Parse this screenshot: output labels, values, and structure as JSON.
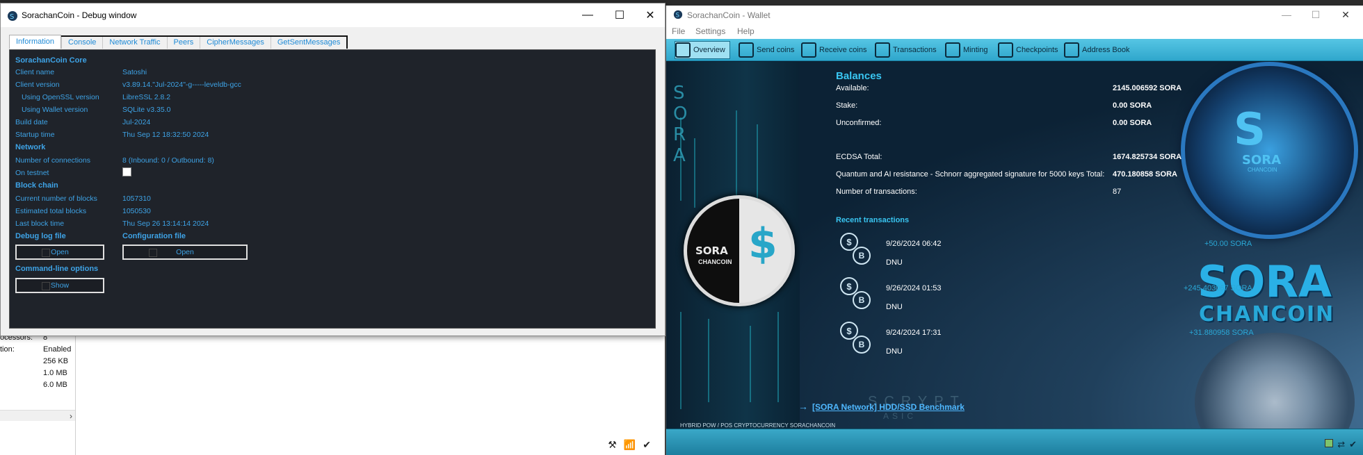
{
  "background": {
    "rows": [
      {
        "label": "ocessors:",
        "value": "8"
      },
      {
        "label": "tion:",
        "value": "Enabled"
      },
      {
        "label": "",
        "value": "256 KB"
      },
      {
        "label": "",
        "value": "1.0 MB"
      },
      {
        "label": "",
        "value": "6.0 MB"
      }
    ],
    "status_icons": [
      "⚒",
      "📶",
      "✔"
    ]
  },
  "debug": {
    "title": "SorachanCoin - Debug window",
    "tabs": [
      "Information",
      "Console",
      "Network Traffic",
      "Peers",
      "CipherMessages",
      "GetSentMessages"
    ],
    "active_tab": 0,
    "sections": {
      "core": "SorachanCoin Core",
      "network": "Network",
      "blockchain": "Block chain",
      "debug_log": "Debug log file",
      "config_file": "Configuration file",
      "cmdline": "Command-line options"
    },
    "info": {
      "client_name": {
        "label": "Client name",
        "value": "Satoshi"
      },
      "client_version": {
        "label": "Client version",
        "value": "v3.89.14.\"Jul-2024\"-g-----leveldb-gcc"
      },
      "openssl": {
        "label": "Using OpenSSL version",
        "value": "LibreSSL 2.8.2"
      },
      "wallet_ver": {
        "label": "Using Wallet version",
        "value": "SQLite v3.35.0"
      },
      "build_date": {
        "label": "Build date",
        "value": "Jul-2024"
      },
      "startup": {
        "label": "Startup time",
        "value": "Thu Sep 12 18:32:50 2024"
      },
      "connections": {
        "label": "Number of connections",
        "value": "8 (Inbound: 0 / Outbound: 8)"
      },
      "testnet": {
        "label": "On testnet",
        "value": ""
      },
      "cur_blocks": {
        "label": "Current number of blocks",
        "value": "1057310"
      },
      "est_blocks": {
        "label": "Estimated total blocks",
        "value": "1050530"
      },
      "last_block": {
        "label": "Last block time",
        "value": "Thu Sep 26 13:14:14 2024"
      }
    },
    "buttons": {
      "open_log": "Open",
      "open_config": "Open",
      "show": "Show"
    }
  },
  "wallet": {
    "title": "SorachanCoin - Wallet",
    "menu": [
      "File",
      "Settings",
      "Help"
    ],
    "toolbar": [
      "Overview",
      "Send coins",
      "Receive coins",
      "Transactions",
      "Minting",
      "Checkpoints",
      "Address Book"
    ],
    "active_toolbar": 0,
    "art": {
      "sora_letters": "S O R A",
      "coin_text": "SORA",
      "coin_sub": "CHANCOIN",
      "coin_dollar": "$",
      "big_coin_logo": "S",
      "big_coin_sora": "SORA",
      "big_coin_chan": "CHANCOIN",
      "big_sora": "SORA",
      "big_chan": "CHANCOIN",
      "scrypt": "SCRYPT",
      "asic": "ASIC"
    },
    "balances": {
      "title": "Balances",
      "available": {
        "label": "Available:",
        "value": "2145.006592 SORA"
      },
      "stake": {
        "label": "Stake:",
        "value": "0.00 SORA"
      },
      "unconfirmed": {
        "label": "Unconfirmed:",
        "value": "0.00 SORA"
      },
      "ecdsa": {
        "label": "ECDSA Total:",
        "value": "1674.825734 SORA"
      },
      "quantum": {
        "label": "Quantum and AI resistance - Schnorr aggregated signature for 5000 keys Total:",
        "value": "470.180858 SORA"
      },
      "num_tx": {
        "label": "Number of transactions:",
        "value": "87"
      }
    },
    "recent": {
      "title": "Recent transactions",
      "items": [
        {
          "date": "9/26/2024 06:42",
          "label": "DNU",
          "amount": "+50.00 SORA"
        },
        {
          "date": "9/26/2024 01:53",
          "label": "DNU",
          "amount": "+245.403067 SORA"
        },
        {
          "date": "9/24/2024 17:31",
          "label": "DNU",
          "amount": "+31.880958 SORA"
        }
      ]
    },
    "bench_link": "[SORA Network] HDD/SSD Benchmark",
    "hybrid_text": "HYBRID POW / POS CRYPTOCURRENCY SORACHANCOIN",
    "status_icons": [
      "▣",
      "⇄",
      "✔"
    ]
  }
}
